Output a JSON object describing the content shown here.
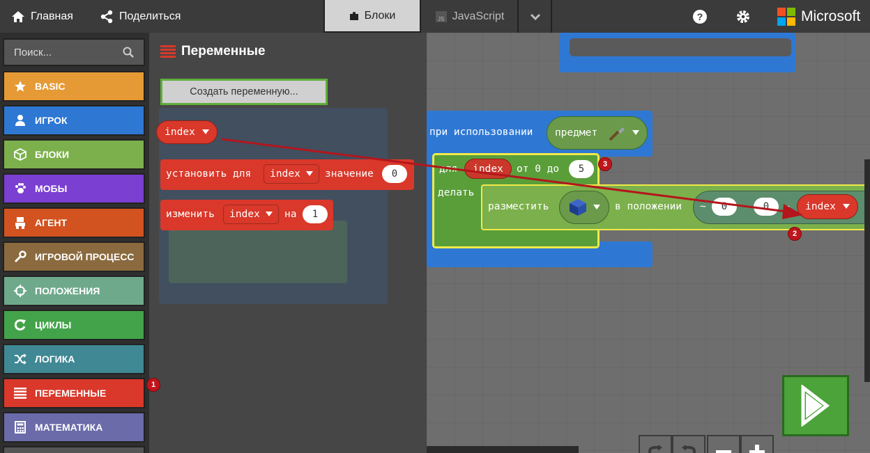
{
  "topbar": {
    "home_label": "Главная",
    "share_label": "Поделиться",
    "tab_blocks": "Блоки",
    "tab_js": "JavaScript",
    "brand": "Microsoft"
  },
  "search": {
    "placeholder": "Поиск..."
  },
  "categories": [
    {
      "label": "BASIC",
      "color": "#e59a35"
    },
    {
      "label": "ИГРОК",
      "color": "#2e78d4"
    },
    {
      "label": "БЛОКИ",
      "color": "#7cb04c"
    },
    {
      "label": "МОБЫ",
      "color": "#7b3fd1"
    },
    {
      "label": "АГЕНТ",
      "color": "#d25320"
    },
    {
      "label": "ИГРОВОЙ ПРОЦЕСС",
      "color": "#8a6a3e"
    },
    {
      "label": "ПОЛОЖЕНИЯ",
      "color": "#6fa98c"
    },
    {
      "label": "ЦИКЛЫ",
      "color": "#43a34a"
    },
    {
      "label": "ЛОГИКА",
      "color": "#3f8894"
    },
    {
      "label": "ПЕРЕМЕННЫЕ",
      "color": "#d9382a"
    },
    {
      "label": "МАТЕМАТИКА",
      "color": "#6a6ba8"
    }
  ],
  "flyout": {
    "title": "Переменные",
    "create_button": "Создать переменную...",
    "var_block": "index",
    "set_block": {
      "prefix": "установить для",
      "var": "index",
      "suffix": "значение",
      "value": "0"
    },
    "change_block": {
      "prefix": "изменить",
      "var": "index",
      "mid": "на",
      "value": "1"
    }
  },
  "workspace": {
    "event_label": "при использовании",
    "event_item": "предмет",
    "loop_prefix": "для",
    "loop_var": "index",
    "loop_from": "от 0 до",
    "loop_to": "5",
    "loop_do": "делать",
    "place_label": "разместить",
    "place_pos": "в положении",
    "coord1": "0",
    "coord2": "0",
    "coord_var": "index"
  },
  "badges": [
    "1",
    "2",
    "3"
  ]
}
